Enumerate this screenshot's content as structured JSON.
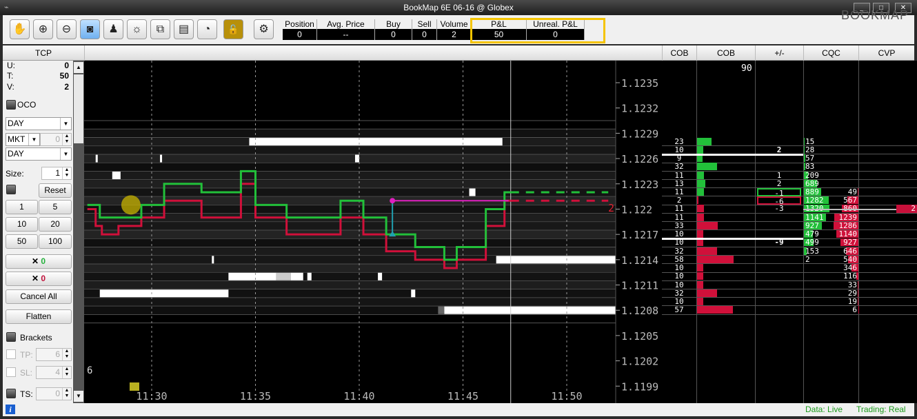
{
  "window": {
    "title": "BookMap   6E 06-16 @ Globex",
    "buttons": [
      "_",
      "□",
      "✕"
    ]
  },
  "toolbar": {
    "icons": [
      "hand-icon",
      "zoom-in-icon",
      "zoom-out-icon",
      "camera-icon",
      "microscope-icon",
      "brightness-icon",
      "copy-icon",
      "chat-icon",
      "clock-icon",
      "unlock-icon",
      "gear-icon"
    ],
    "icon_glyphs": [
      "✋",
      "⊕",
      "⊖",
      "◙",
      "♟",
      "☼",
      "⧉",
      "▤",
      "◔",
      "🔓",
      "⚙"
    ],
    "stats": [
      {
        "label": "Position",
        "value": "0"
      },
      {
        "label": "Avg. Price",
        "value": "--"
      },
      {
        "label": "Buy",
        "value": "0"
      },
      {
        "label": "Sell",
        "value": "0"
      },
      {
        "label": "Volume",
        "value": "2"
      },
      {
        "label": "P&L",
        "value": "50"
      },
      {
        "label": "Unreal. P&L",
        "value": "0"
      }
    ],
    "logo": "BOOKMAP",
    "highlight_color": "#f5c400"
  },
  "header": {
    "tcp": "TCP",
    "columns": [
      "COB",
      "COB",
      "+/-",
      "CQC",
      "CVP"
    ]
  },
  "left_panel": {
    "u_label": "U:",
    "u_value": "0",
    "t_label": "T:",
    "t_value": "50",
    "v_label": "V:",
    "v_value": "2",
    "oco": "OCO",
    "tif1": "DAY",
    "order_type": "MKT",
    "price_value": "0",
    "tif2": "DAY",
    "size_label": "Size:",
    "size_value": "1",
    "reset": "Reset",
    "qty_buttons": [
      "1",
      "5",
      "10",
      "20",
      "50",
      "100"
    ],
    "cancel_buy_count": "0",
    "cancel_sell_count": "0",
    "cancel_all": "Cancel All",
    "flatten": "Flatten",
    "brackets": "Brackets",
    "tp_label": "TP:",
    "tp_value": "6",
    "sl_label": "SL:",
    "sl_value": "4",
    "ts_label": "TS:",
    "ts_value": "0"
  },
  "status": {
    "data": "Data: Live",
    "trading": "Trading: Real"
  },
  "chart_data": {
    "type": "heatmap",
    "price_ticks": [
      "1.1235",
      "1.1232",
      "1.1229",
      "1.1226",
      "1.1223",
      "1.122",
      "1.1217",
      "1.1214",
      "1.1211",
      "1.1208",
      "1.1205",
      "1.1202",
      "1.1199"
    ],
    "price_range": [
      1.1199,
      1.1235
    ],
    "time_ticks": [
      "11:30",
      "11:35",
      "11:40",
      "11:45",
      "11:50"
    ],
    "time_tick_minutes": [
      30,
      35,
      40,
      45,
      50
    ],
    "current_time_minute": 47.3,
    "ask_series": [
      [
        26.9,
        1.12205
      ],
      [
        27.5,
        1.1219
      ],
      [
        29.3,
        1.1219
      ],
      [
        29.5,
        1.12205
      ],
      [
        30.5,
        1.12205
      ],
      [
        30.6,
        1.1223
      ],
      [
        32.3,
        1.1223
      ],
      [
        32.4,
        1.1222
      ],
      [
        34,
        1.1222
      ],
      [
        34.3,
        1.12245
      ],
      [
        34.8,
        1.12245
      ],
      [
        35,
        1.12205
      ],
      [
        36.3,
        1.12205
      ],
      [
        36.5,
        1.1219
      ],
      [
        39,
        1.1219
      ],
      [
        39.1,
        1.1221
      ],
      [
        40,
        1.1221
      ],
      [
        40.2,
        1.1219
      ],
      [
        41.1,
        1.1219
      ],
      [
        41.3,
        1.1217
      ],
      [
        42.6,
        1.1217
      ],
      [
        42.7,
        1.12155
      ],
      [
        44,
        1.12155
      ],
      [
        44.1,
        1.1214
      ],
      [
        44.6,
        1.1214
      ],
      [
        44.7,
        1.12155
      ],
      [
        45.9,
        1.12155
      ],
      [
        46.1,
        1.122
      ],
      [
        46.9,
        1.122
      ],
      [
        47,
        1.1222
      ],
      [
        47.3,
        1.1222
      ]
    ],
    "bid_series": [
      [
        26.9,
        1.122
      ],
      [
        27.3,
        1.1218
      ],
      [
        27.6,
        1.1217
      ],
      [
        28.3,
        1.1217
      ],
      [
        28.4,
        1.1218
      ],
      [
        29.3,
        1.1218
      ],
      [
        29.5,
        1.1219
      ],
      [
        30.5,
        1.1219
      ],
      [
        30.6,
        1.1221
      ],
      [
        32.3,
        1.1221
      ],
      [
        32.4,
        1.1219
      ],
      [
        34,
        1.1219
      ],
      [
        34.3,
        1.1223
      ],
      [
        34.8,
        1.1223
      ],
      [
        35,
        1.1219
      ],
      [
        36.3,
        1.1219
      ],
      [
        36.5,
        1.1217
      ],
      [
        39,
        1.1217
      ],
      [
        39.1,
        1.1219
      ],
      [
        40,
        1.1219
      ],
      [
        40.2,
        1.1217
      ],
      [
        41.1,
        1.1217
      ],
      [
        41.3,
        1.1215
      ],
      [
        42.6,
        1.1215
      ],
      [
        42.7,
        1.1214
      ],
      [
        44,
        1.1214
      ],
      [
        44.1,
        1.1213
      ],
      [
        44.6,
        1.1213
      ],
      [
        44.7,
        1.1214
      ],
      [
        45.9,
        1.1214
      ],
      [
        46.1,
        1.1218
      ],
      [
        46.9,
        1.1218
      ],
      [
        47,
        1.1221
      ],
      [
        47.3,
        1.1221
      ]
    ],
    "ask_projection_price": 1.1222,
    "bid_projection_price": 1.1221,
    "projection_end_minute": 52,
    "liquidity_bars": [
      {
        "price": 1.1228,
        "from": 34.7,
        "to": 46.9,
        "shade": "#ffffff"
      },
      {
        "price": 1.1226,
        "from": 27.3,
        "to": 27.4,
        "shade": "#ffffff"
      },
      {
        "price": 1.1226,
        "from": 30.4,
        "to": 30.5,
        "shade": "#ffffff"
      },
      {
        "price": 1.1226,
        "from": 39.8,
        "to": 40,
        "shade": "#ffffff"
      },
      {
        "price": 1.1224,
        "from": 28.1,
        "to": 28.5,
        "shade": "#ffffff"
      },
      {
        "price": 1.1222,
        "from": 45.3,
        "to": 45.6,
        "shade": "#ffffff"
      },
      {
        "price": 1.1214,
        "from": 32.9,
        "to": 33,
        "shade": "#ffffff"
      },
      {
        "price": 1.1214,
        "from": 46.6,
        "to": 52.5,
        "shade": "#ffffff"
      },
      {
        "price": 1.1212,
        "from": 33.7,
        "to": 36,
        "shade": "#ffffff"
      },
      {
        "price": 1.1212,
        "from": 36,
        "to": 36.7,
        "shade": "#cccccc"
      },
      {
        "price": 1.1212,
        "from": 36.7,
        "to": 37.3,
        "shade": "#ffffff"
      },
      {
        "price": 1.1212,
        "from": 37.5,
        "to": 37.7,
        "shade": "#ffffff"
      },
      {
        "price": 1.1212,
        "from": 40.9,
        "to": 41.1,
        "shade": "#ffffff"
      },
      {
        "price": 1.121,
        "from": 27.5,
        "to": 33.7,
        "shade": "#ffffff"
      },
      {
        "price": 1.121,
        "from": 42.5,
        "to": 42.7,
        "shade": "#ffffff"
      },
      {
        "price": 1.1208,
        "from": 43.8,
        "to": 44.1,
        "shade": "#666666"
      },
      {
        "price": 1.1208,
        "from": 44.1,
        "to": 52.5,
        "shade": "#ffffff"
      }
    ],
    "trade_marker": {
      "minute": 29.0,
      "price": 1.12205,
      "color": "#c8b400"
    },
    "order_line": {
      "from": 41.6,
      "to": 47.2,
      "price": 1.1221,
      "entry_price": 1.1217
    },
    "position_label": "2",
    "volume_bar_label": "6",
    "cob_max_label": "90"
  },
  "order_book": {
    "rows": [
      {
        "price": 1.1228,
        "cob": "23",
        "side": "bid",
        "pm": "",
        "cqc": "15",
        "cvp": ""
      },
      {
        "price": 1.1227,
        "cob": "10",
        "side": "bid",
        "pm": "2",
        "cqc": "28",
        "cvp": ""
      },
      {
        "price": 1.1226,
        "cob": "9",
        "side": "bid",
        "pm": "",
        "cqc": "57",
        "cvp": ""
      },
      {
        "price": 1.1225,
        "cob": "32",
        "side": "bid",
        "pm": "",
        "cqc": "83",
        "cvp": ""
      },
      {
        "price": 1.1224,
        "cob": "11",
        "side": "bid",
        "pm": "1",
        "cqc": "209",
        "cvp": ""
      },
      {
        "price": 1.1223,
        "cob": "13",
        "side": "bid",
        "pm": "2",
        "cqc": "689",
        "cvp": ""
      },
      {
        "price": 1.1222,
        "cob": "11",
        "side": "bid",
        "pm": "-1",
        "cqc": "889",
        "cvp": "49"
      },
      {
        "price": 1.1221,
        "cob": "2",
        "side": "ask",
        "pm": "-6",
        "cqc": "1282",
        "cvp": "567"
      },
      {
        "price": 1.122,
        "cob": "11",
        "side": "ask",
        "pm": "-3",
        "cqc": "1320",
        "cvp": "860"
      },
      {
        "price": 1.1219,
        "cob": "11",
        "side": "ask",
        "pm": "",
        "cqc": "1141",
        "cvp": "1239"
      },
      {
        "price": 1.1218,
        "cob": "33",
        "side": "ask",
        "pm": "",
        "cqc": "927",
        "cvp": "1286"
      },
      {
        "price": 1.1217,
        "cob": "10",
        "side": "ask",
        "pm": "",
        "cqc": "479",
        "cvp": "1140"
      },
      {
        "price": 1.1216,
        "cob": "10",
        "side": "ask",
        "pm": "-9",
        "cqc": "499",
        "cvp": "927"
      },
      {
        "price": 1.1215,
        "cob": "32",
        "side": "ask",
        "pm": "",
        "cqc": "153",
        "cvp": "646"
      },
      {
        "price": 1.1214,
        "cob": "58",
        "side": "ask",
        "pm": "",
        "cqc": "2",
        "cvp": "540"
      },
      {
        "price": 1.1213,
        "cob": "10",
        "side": "ask",
        "pm": "",
        "cqc": "",
        "cvp": "346"
      },
      {
        "price": 1.1212,
        "cob": "10",
        "side": "ask",
        "pm": "",
        "cqc": "",
        "cvp": "116"
      },
      {
        "price": 1.1211,
        "cob": "10",
        "side": "ask",
        "pm": "",
        "cqc": "",
        "cvp": "33"
      },
      {
        "price": 1.121,
        "cob": "32",
        "side": "ask",
        "pm": "",
        "cqc": "",
        "cvp": "29"
      },
      {
        "price": 1.1209,
        "cob": "10",
        "side": "ask",
        "pm": "",
        "cqc": "",
        "cvp": "19"
      },
      {
        "price": 1.1208,
        "cob": "57",
        "side": "ask",
        "pm": "",
        "cqc": "",
        "cvp": "6"
      }
    ],
    "last_trade_size": "2",
    "colors": {
      "bid": "#22c03a",
      "ask": "#d0103a"
    }
  }
}
